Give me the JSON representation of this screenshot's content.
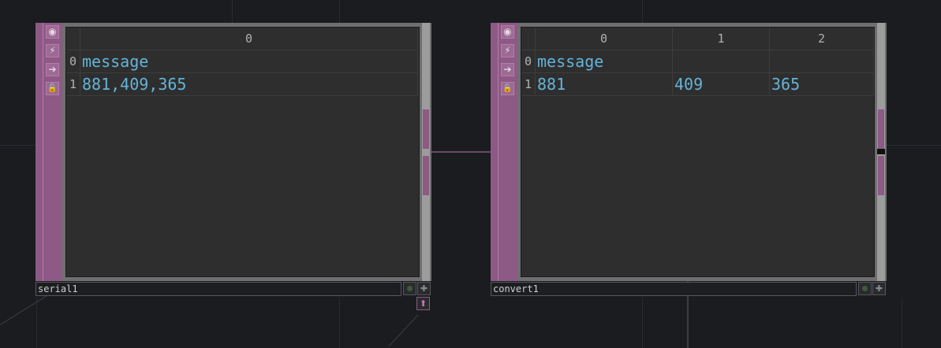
{
  "nodes": {
    "serial1": {
      "name": "serial1",
      "columns": [
        "0"
      ],
      "rows": [
        {
          "index": "0",
          "cells": [
            "message"
          ]
        },
        {
          "index": "1",
          "cells": [
            "881,409,365"
          ]
        }
      ]
    },
    "convert1": {
      "name": "convert1",
      "columns": [
        "0",
        "1",
        "2"
      ],
      "rows": [
        {
          "index": "0",
          "cells": [
            "message",
            "",
            ""
          ]
        },
        {
          "index": "1",
          "cells": [
            "881",
            "409",
            "365"
          ]
        }
      ]
    }
  },
  "icons": {
    "viewer": "◉",
    "cook": "⚡",
    "display": "➔",
    "lock": "🔓",
    "bypass": "●",
    "pin": "✚",
    "output": "⬆"
  },
  "colors": {
    "background": "#1b1c20",
    "node_flag": "#8c5a84",
    "table_bg": "#2e2e2e",
    "cell_text": "#64b4d8",
    "wire": "#d86cb8"
  }
}
